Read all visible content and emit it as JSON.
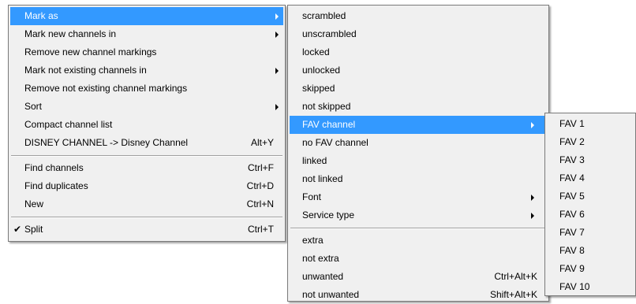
{
  "menu_main": {
    "items": [
      {
        "label": "Mark as",
        "submenu": true
      },
      {
        "label": "Mark new channels in",
        "submenu": true
      },
      {
        "label": "Remove new channel markings"
      },
      {
        "label": "Mark not existing channels in",
        "submenu": true
      },
      {
        "label": "Remove not existing channel markings"
      },
      {
        "label": "Sort",
        "submenu": true
      },
      {
        "label": "Compact channel list"
      },
      {
        "label": "DISNEY CHANNEL -> Disney Channel",
        "shortcut": "Alt+Y"
      },
      {
        "label": "Find channels",
        "shortcut": "Ctrl+F"
      },
      {
        "label": "Find duplicates",
        "shortcut": "Ctrl+D"
      },
      {
        "label": "New",
        "shortcut": "Ctrl+N"
      },
      {
        "label": "Split",
        "shortcut": "Ctrl+T",
        "check": "✔"
      }
    ]
  },
  "menu_mark_as": {
    "items": [
      {
        "label": "scrambled"
      },
      {
        "label": "unscrambled"
      },
      {
        "label": "locked"
      },
      {
        "label": "unlocked"
      },
      {
        "label": "skipped"
      },
      {
        "label": "not skipped"
      },
      {
        "label": "FAV channel",
        "submenu": true
      },
      {
        "label": "no FAV channel"
      },
      {
        "label": "linked"
      },
      {
        "label": "not linked"
      },
      {
        "label": "Font",
        "submenu": true
      },
      {
        "label": "Service type",
        "submenu": true
      },
      {
        "label": "extra"
      },
      {
        "label": "not extra"
      },
      {
        "label": "unwanted",
        "shortcut": "Ctrl+Alt+K"
      },
      {
        "label": "not unwanted",
        "shortcut": "Shift+Alt+K"
      }
    ]
  },
  "menu_fav": {
    "items": [
      {
        "label": "FAV 1"
      },
      {
        "label": "FAV 2"
      },
      {
        "label": "FAV 3"
      },
      {
        "label": "FAV 4"
      },
      {
        "label": "FAV 5"
      },
      {
        "label": "FAV 6"
      },
      {
        "label": "FAV 7"
      },
      {
        "label": "FAV 8"
      },
      {
        "label": "FAV 9"
      },
      {
        "label": "FAV 10"
      }
    ]
  },
  "colors": {
    "highlight": "#3399ff",
    "menu_background": "#f0f0f0"
  }
}
